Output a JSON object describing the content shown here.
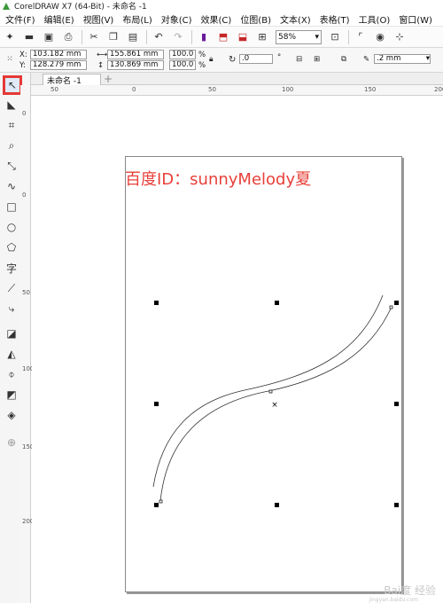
{
  "window": {
    "title": "CorelDRAW X7 (64-Bit) - 未命名 -1"
  },
  "menu": [
    "文件(F)",
    "编辑(E)",
    "视图(V)",
    "布局(L)",
    "对象(C)",
    "效果(C)",
    "位图(B)",
    "文本(X)",
    "表格(T)",
    "工具(O)",
    "窗口(W)"
  ],
  "toolbar": {
    "zoom_value": "58%",
    "icons": [
      "new-icon",
      "open-icon",
      "save-icon",
      "print-icon",
      "cut-icon",
      "copy-icon",
      "paste-icon",
      "undo-icon",
      "redo-icon",
      "import-icon",
      "export-icon",
      "publish-pdf-icon",
      "app-launcher-icon",
      "full-screen-icon",
      "show-rulers-icon",
      "snap-icon"
    ]
  },
  "property_bar": {
    "x_label": "X:",
    "x_value": "103.182 mm",
    "y_label": "Y:",
    "y_value": "128.279 mm",
    "width_value": "155.861 mm",
    "height_value": "130.869 mm",
    "scale_x": "100.0",
    "scale_y": "100.0",
    "percent": "%",
    "rotation_value": ".0",
    "degree": "°",
    "outline_width": ".2 mm"
  },
  "document": {
    "tab_label": "未命名 -1",
    "add_tab": "+"
  },
  "rulers": {
    "horizontal": [
      "50",
      "0",
      "50",
      "100",
      "150",
      "200"
    ],
    "vertical": [
      "0",
      "0",
      "50",
      "100",
      "150",
      "200"
    ]
  },
  "canvas": {
    "watermark_text": "百度ID：sunnyMelody夏"
  },
  "footer": {
    "logo_text": "Bai度 经验",
    "logo_sub": "jingyan.baidu.com"
  },
  "colors": {
    "accent_red": "#e53935",
    "watermark_red": "#e8403a"
  }
}
